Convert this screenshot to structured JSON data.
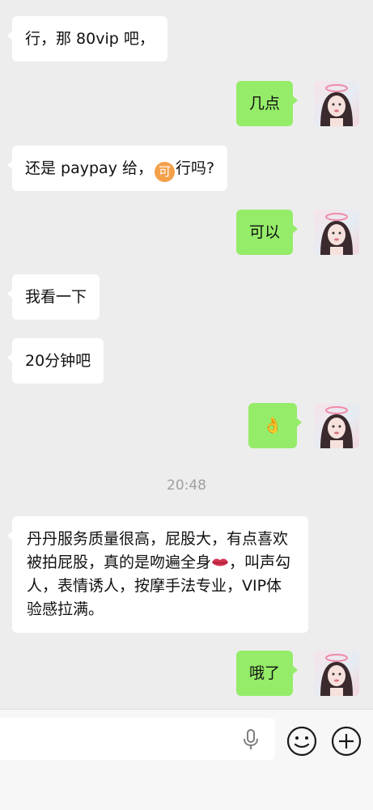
{
  "messages": [
    {
      "side": "left",
      "text": "行，那 80vip 吧，"
    },
    {
      "side": "right",
      "text": "几点"
    },
    {
      "side": "left",
      "text_before": "还是 paypay 给，",
      "badge": "可",
      "text_after": "行吗?"
    },
    {
      "side": "right",
      "text": "可以"
    },
    {
      "side": "left",
      "text": "我看一下"
    },
    {
      "side": "left",
      "text": "20分钟吧"
    },
    {
      "side": "right",
      "emoji": "👌"
    },
    {
      "side": "left",
      "text_before": "丹丹服务质量很高，屁股大，有点喜欢被拍屁股，真的是吻遍全身",
      "text_after": "，叫声勾人，表情诱人，按摩手法专业，VIP体验感拉满。"
    },
    {
      "side": "right",
      "text": "哦了"
    }
  ],
  "timestamp": "20:48",
  "colors": {
    "background": "#ededed",
    "incoming_bubble": "#ffffff",
    "outgoing_bubble": "#95ec69"
  },
  "input_bar": {
    "icons": [
      "microphone-icon",
      "emoji-icon",
      "plus-icon"
    ]
  }
}
